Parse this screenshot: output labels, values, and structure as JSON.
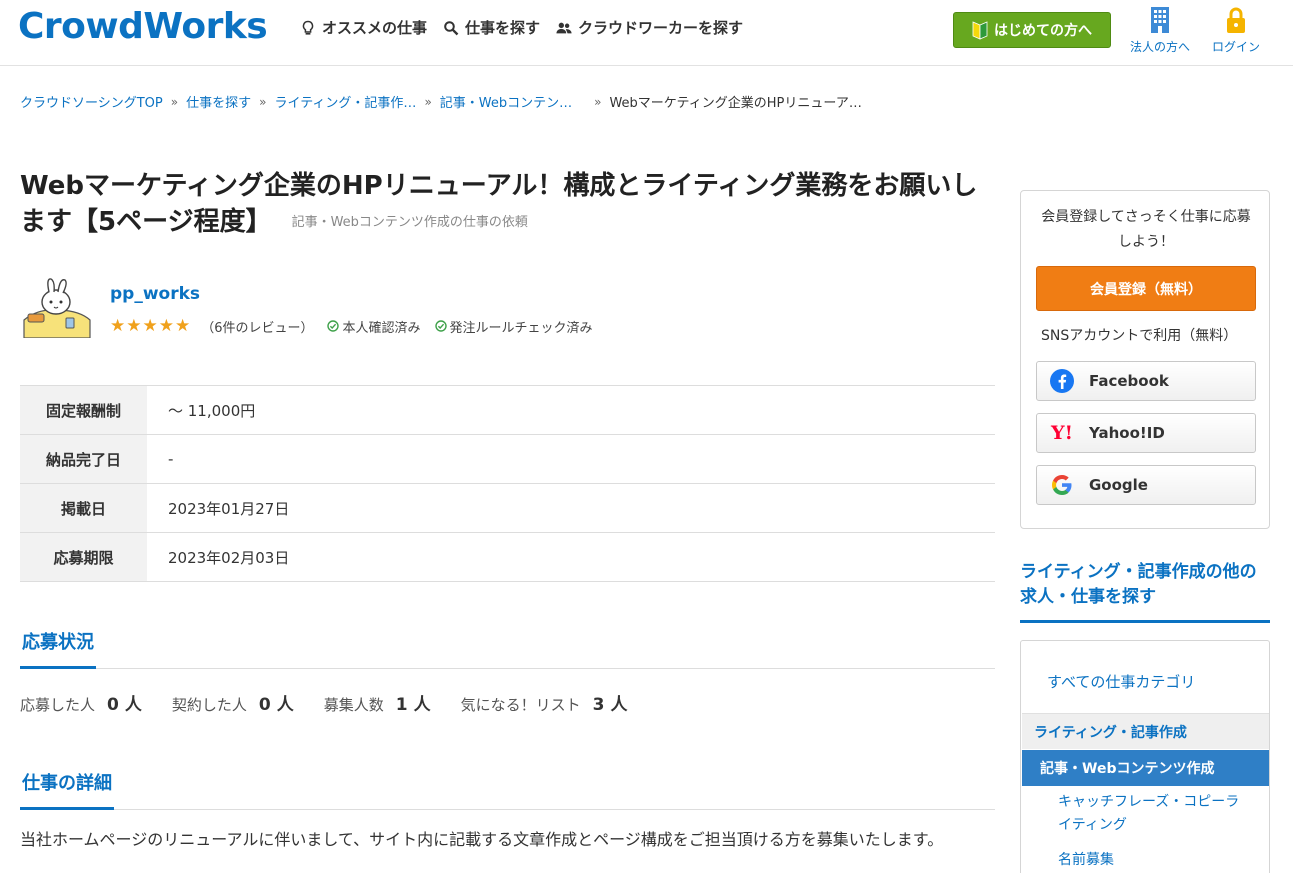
{
  "header": {
    "logo": "CrowdWorks",
    "nav": [
      {
        "label": "オススメの仕事",
        "icon": "lightbulb-icon"
      },
      {
        "label": "仕事を探す",
        "icon": "search-icon"
      },
      {
        "label": "クラウドワーカーを探す",
        "icon": "users-icon"
      }
    ],
    "first_time_label": "はじめての方へ",
    "corporate_label": "法人の方へ",
    "login_label": "ログイン"
  },
  "breadcrumb": [
    "クラウドソーシングTOP",
    "仕事を探す",
    "ライティング・記事作…",
    "記事・Webコンテン…",
    "Webマーケティング企業のHPリニューア…"
  ],
  "job": {
    "title": "Webマーケティング企業のHPリニューアル！構成とライティング業務をお願いします【5ページ程度】",
    "category": "記事・Webコンテンツ作成の仕事の依頼"
  },
  "client": {
    "name": "pp_works",
    "stars": "★★★★★",
    "reviews": "（6件のレビュー）",
    "verified_label": "本人確認済み",
    "rule_check_label": "発注ルールチェック済み"
  },
  "info": [
    {
      "label": "固定報酬制",
      "value": "〜 11,000円"
    },
    {
      "label": "納品完了日",
      "value": "-"
    },
    {
      "label": "掲載日",
      "value": "2023年01月27日"
    },
    {
      "label": "応募期限",
      "value": "2023年02月03日"
    }
  ],
  "status": {
    "heading": "応募状況",
    "items": [
      {
        "label": "応募した人",
        "value": "0",
        "unit": "人"
      },
      {
        "label": "契約した人",
        "value": "0",
        "unit": "人"
      },
      {
        "label": "募集人数",
        "value": "1",
        "unit": "人"
      },
      {
        "label": "気になる！リスト",
        "value": "3",
        "unit": "人"
      }
    ]
  },
  "detail": {
    "heading": "仕事の詳細",
    "text": "当社ホームページのリニューアルに伴いまして、サイト内に記載する文章作成とページ構成をご担当頂ける方を募集いたします。"
  },
  "sidebar": {
    "signup_text": "会員登録してさっそく仕事に応募しよう！",
    "register_label": "会員登録（無料）",
    "sns_text": "SNSアカウントで利用（無料）",
    "sns": [
      {
        "label": "Facebook",
        "icon": "facebook-icon"
      },
      {
        "label": "Yahoo!ID",
        "icon": "yahoo-icon"
      },
      {
        "label": "Google",
        "icon": "google-icon"
      }
    ],
    "category_heading": "ライティング・記事作成の他の求人・仕事を探す",
    "categories": {
      "all": "すべての仕事カテゴリ",
      "level1": "ライティング・記事作成",
      "level2": "記事・Webコンテンツ作成",
      "subs": [
        "キャッチフレーズ・コピーライティング",
        "名前募集"
      ]
    }
  },
  "colors": {
    "brand_blue": "#0b72c2",
    "green_button": "#67a81f",
    "orange_button": "#f07d14",
    "star": "#f0a11c"
  }
}
